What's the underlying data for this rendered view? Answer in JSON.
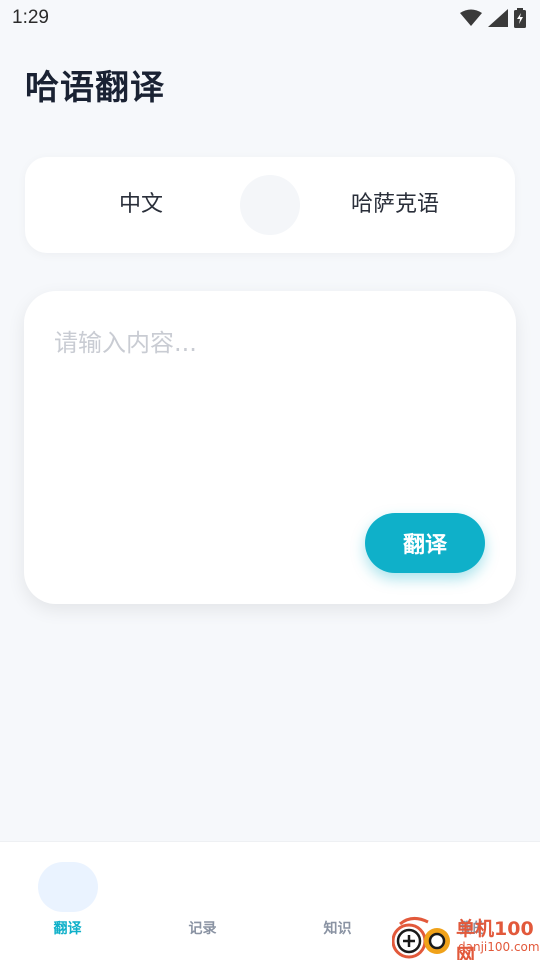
{
  "status_bar": {
    "time": "1:29"
  },
  "page": {
    "title": "哈语翻译"
  },
  "language_selector": {
    "source": "中文",
    "target": "哈萨克语"
  },
  "input": {
    "placeholder": "请输入内容...",
    "value": ""
  },
  "actions": {
    "translate_label": "翻译"
  },
  "bottom_nav": {
    "items": [
      {
        "label": "翻译",
        "active": true
      },
      {
        "label": "记录",
        "active": false
      },
      {
        "label": "知识",
        "active": false
      },
      {
        "label": "我的",
        "active": false
      }
    ]
  },
  "watermark": {
    "line1": "单机100网",
    "line2": "danji100.com"
  },
  "colors": {
    "accent": "#0fb0c9",
    "background": "#f6f8fb",
    "inactive": "#8a93a3",
    "watermark": "#e2593b"
  }
}
